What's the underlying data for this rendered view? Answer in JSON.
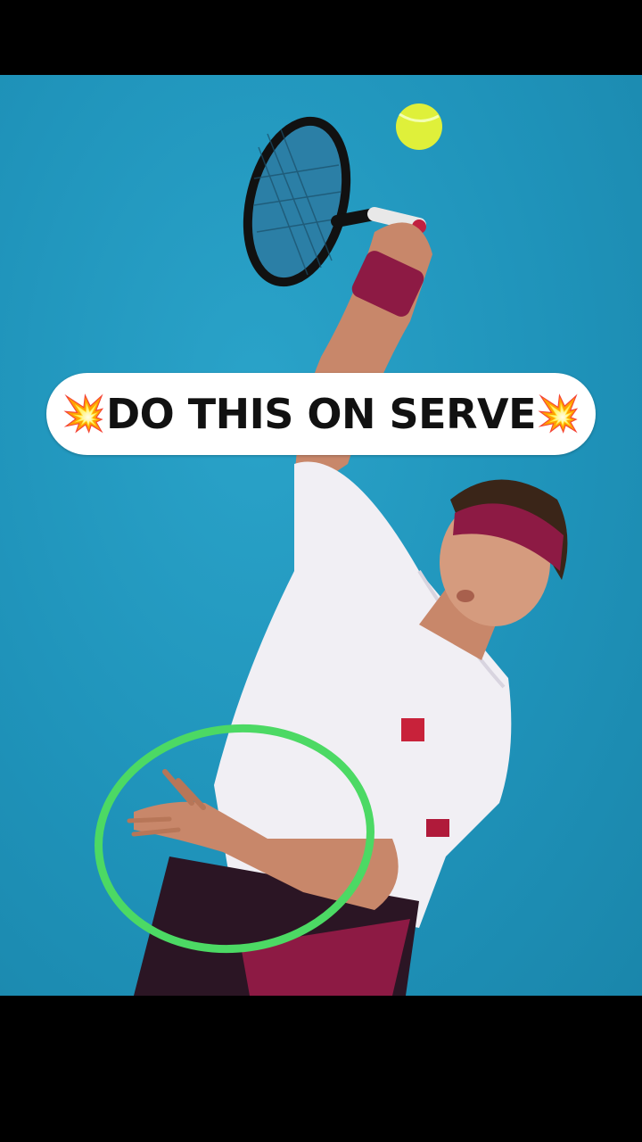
{
  "caption": {
    "text": "DO THIS ON SERVE",
    "left_emoji": "💥",
    "right_emoji": "💥"
  },
  "photo": {
    "description_icons": [
      "tennis-ball",
      "tennis-racket",
      "green-highlight-circle"
    ],
    "court_color": "#1f93ba",
    "highlight_color": "#4cd964"
  }
}
